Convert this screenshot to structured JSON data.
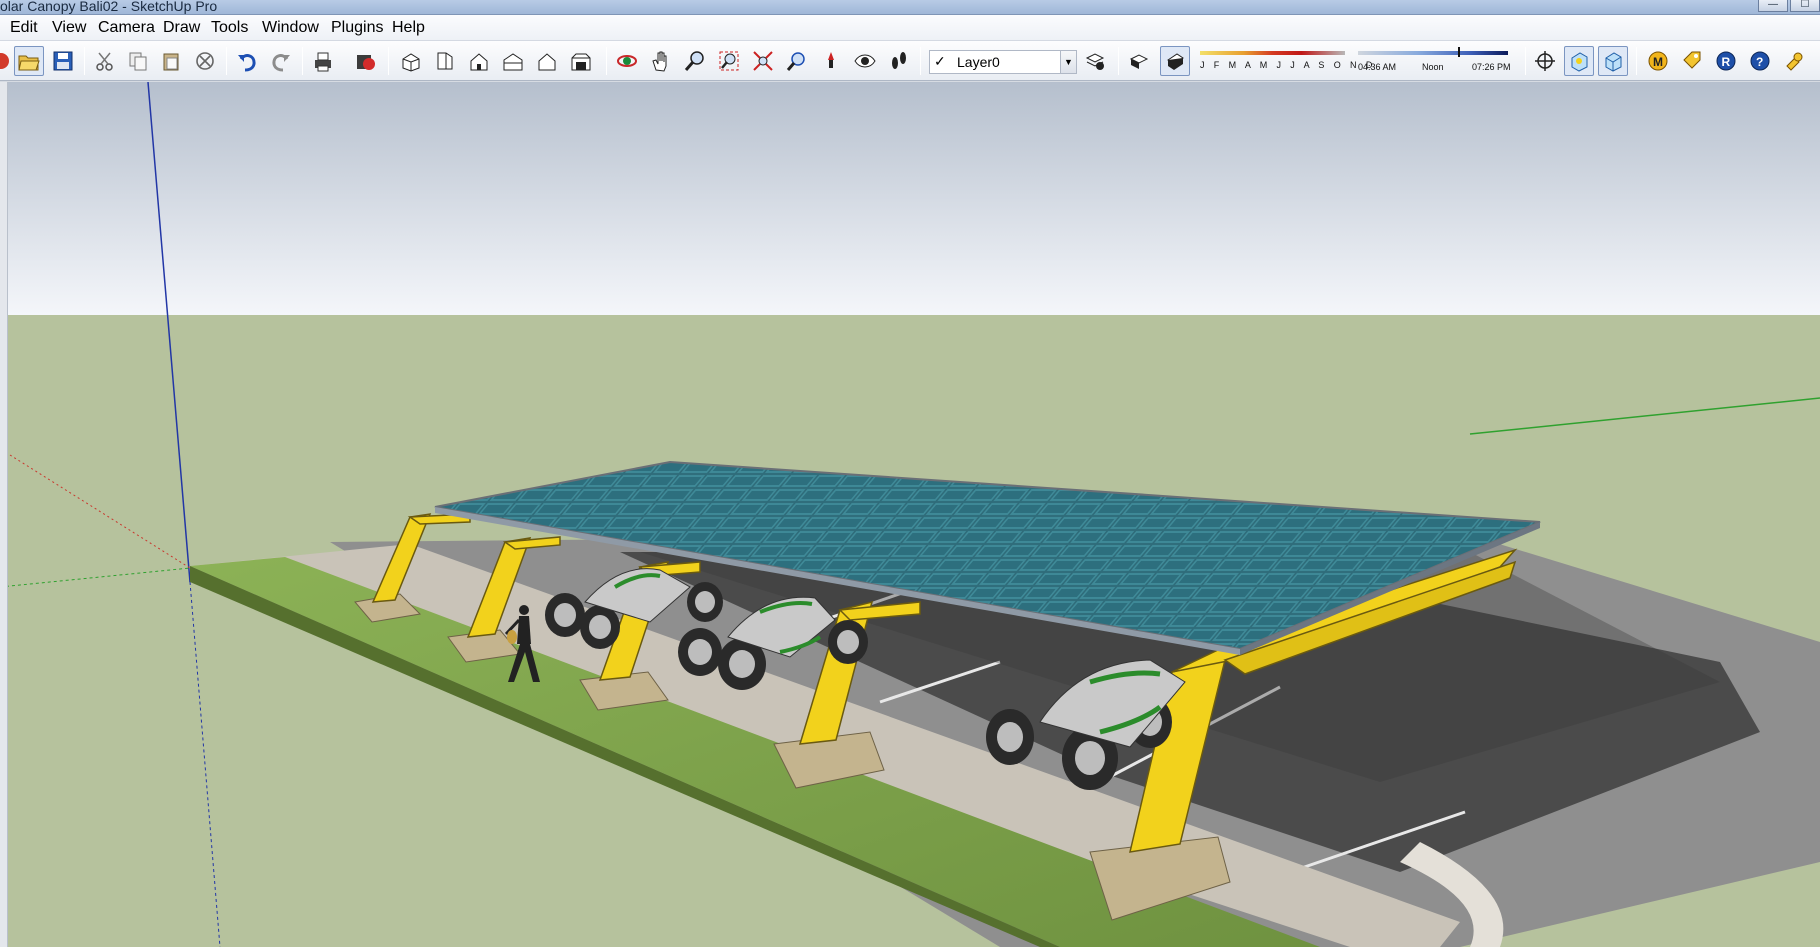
{
  "window": {
    "title": "olar Canopy Bali02 - SketchUp Pro",
    "minimize_glyph": "—",
    "maximize_glyph": "☐"
  },
  "menu": {
    "items": [
      "Edit",
      "View",
      "Camera",
      "Draw",
      "Tools",
      "Window",
      "Plugins",
      "Help"
    ]
  },
  "toolbar": {
    "layer": {
      "checked": "✓",
      "name": "Layer0",
      "dropdown_glyph": "▼"
    },
    "shadow_months": "J F M A M J J A S O N D",
    "shadow_time_start": "04:36 AM",
    "shadow_time_noon": "Noon",
    "shadow_time_end": "07:26 PM",
    "icons": [
      "get-models-icon",
      "open-icon",
      "save-icon",
      "cut-icon",
      "copy-icon",
      "paste-icon",
      "erase-icon",
      "undo-icon",
      "redo-icon",
      "print-icon",
      "model-info-icon",
      "iso-view-icon",
      "top-view-icon",
      "front-view-icon",
      "right-view-icon",
      "back-view-icon",
      "left-view-icon",
      "orbit-icon",
      "pan-icon",
      "zoom-icon",
      "zoom-window-icon",
      "zoom-extents-icon",
      "previous-view-icon",
      "position-camera-icon",
      "look-around-icon",
      "walk-icon",
      "layer-manager-icon",
      "shadow-settings-icon",
      "display-shadows-icon",
      "axes-icon",
      "section-plane-icon",
      "section-cut-icon",
      "plugin-m-icon",
      "plugin-tag-icon",
      "plugin-r-icon",
      "help-icon",
      "plugin-key-icon"
    ]
  },
  "colors": {
    "sky_top": "#b7c0cd",
    "sky_horizon": "#f3f5f9",
    "ground": "#b6c29d",
    "canopy_frame": "#f2d21c",
    "solar_panel": "#2e6a78",
    "asphalt": "#4a4a4a",
    "sidewalk": "#c9c3b8",
    "grass": "#7ea04a",
    "axis_red": "#c8382e",
    "axis_green": "#2fa12f",
    "axis_blue": "#2236a6"
  }
}
